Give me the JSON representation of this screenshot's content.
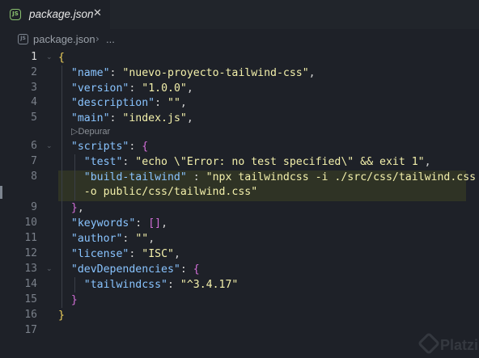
{
  "tab": {
    "icon": "js-file-icon",
    "icon_text": "JS",
    "label": "package.json",
    "close_glyph": "✕"
  },
  "breadcrumb": {
    "icon_text": "JS",
    "file": "package.json",
    "separator": "›",
    "more": "..."
  },
  "editor": {
    "active_line": 1,
    "codelens": "▷Depurar",
    "line_numbers": [
      "1",
      "2",
      "3",
      "4",
      "5",
      "6",
      "7",
      "8",
      "9",
      "10",
      "11",
      "12",
      "13",
      "14",
      "15",
      "16",
      "17"
    ],
    "lines": [
      [
        [
          "b1",
          "{"
        ]
      ],
      [
        [
          "p",
          "  "
        ],
        [
          "k",
          "\"name\""
        ],
        [
          "p",
          ": "
        ],
        [
          "s",
          "\"nuevo-proyecto-tailwind-css\""
        ],
        [
          "p",
          ","
        ]
      ],
      [
        [
          "p",
          "  "
        ],
        [
          "k",
          "\"version\""
        ],
        [
          "p",
          ": "
        ],
        [
          "s",
          "\"1.0.0\""
        ],
        [
          "p",
          ","
        ]
      ],
      [
        [
          "p",
          "  "
        ],
        [
          "k",
          "\"description\""
        ],
        [
          "p",
          ": "
        ],
        [
          "s",
          "\"\""
        ],
        [
          "p",
          ","
        ]
      ],
      [
        [
          "p",
          "  "
        ],
        [
          "k",
          "\"main\""
        ],
        [
          "p",
          ": "
        ],
        [
          "s",
          "\"index.js\""
        ],
        [
          "p",
          ","
        ]
      ],
      [
        [
          "p",
          "  "
        ],
        [
          "k",
          "\"scripts\""
        ],
        [
          "p",
          ": "
        ],
        [
          "b2",
          "{"
        ]
      ],
      [
        [
          "p",
          "    "
        ],
        [
          "k",
          "\"test\""
        ],
        [
          "p",
          ": "
        ],
        [
          "s",
          "\"echo \\\"Error: no test specified\\\" && exit 1\""
        ],
        [
          "p",
          ","
        ]
      ],
      [
        [
          "p",
          "    "
        ],
        [
          "k",
          "\"build-tailwind\""
        ],
        [
          "p",
          " : "
        ],
        [
          "s",
          "\"npx tailwindcss -i ./src/css/tailwind.css"
        ]
      ],
      [
        [
          "p",
          "    "
        ],
        [
          "s",
          "-o public/css/tailwind.css\""
        ]
      ],
      [
        [
          "p",
          "  "
        ],
        [
          "b2",
          "}"
        ],
        [
          "p",
          ","
        ]
      ],
      [
        [
          "p",
          "  "
        ],
        [
          "k",
          "\"keywords\""
        ],
        [
          "p",
          ": "
        ],
        [
          "b2",
          "[]"
        ],
        [
          "p",
          ","
        ]
      ],
      [
        [
          "p",
          "  "
        ],
        [
          "k",
          "\"author\""
        ],
        [
          "p",
          ": "
        ],
        [
          "s",
          "\"\""
        ],
        [
          "p",
          ","
        ]
      ],
      [
        [
          "p",
          "  "
        ],
        [
          "k",
          "\"license\""
        ],
        [
          "p",
          ": "
        ],
        [
          "s",
          "\"ISC\""
        ],
        [
          "p",
          ","
        ]
      ],
      [
        [
          "p",
          "  "
        ],
        [
          "k",
          "\"devDependencies\""
        ],
        [
          "p",
          ": "
        ],
        [
          "b2",
          "{"
        ]
      ],
      [
        [
          "p",
          "    "
        ],
        [
          "k",
          "\"tailwindcss\""
        ],
        [
          "p",
          ": "
        ],
        [
          "s",
          "\"^3.4.17\""
        ]
      ],
      [
        [
          "p",
          "  "
        ],
        [
          "b2",
          "}"
        ]
      ],
      [
        [
          "b1",
          "}"
        ]
      ],
      []
    ]
  },
  "watermark": {
    "text": "Platzi"
  },
  "colors": {
    "background": "#1e2128",
    "key": "#89c4ff",
    "string": "#f3f0ab",
    "bracket_outer": "#f0d25c",
    "bracket_inner": "#d46fd9",
    "highlight": "#2f3325"
  }
}
